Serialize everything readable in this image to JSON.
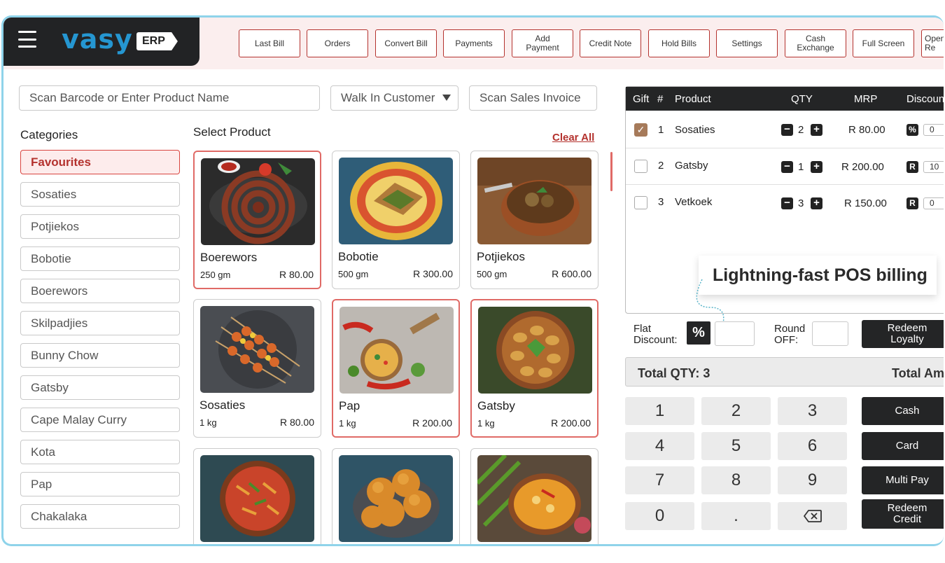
{
  "app": {
    "logo_text": "vasy",
    "logo_badge": "ERP"
  },
  "toolbar": [
    {
      "label": "Last Bill"
    },
    {
      "label": "Orders"
    },
    {
      "label": "Convert Bill"
    },
    {
      "label": "Payments"
    },
    {
      "label": "Add Payment"
    },
    {
      "label": "Credit Note"
    },
    {
      "label": "Hold Bills"
    },
    {
      "label": "Settings"
    },
    {
      "label": "Cash Exchange"
    },
    {
      "label": "Full Screen"
    },
    {
      "label": "Open Re"
    }
  ],
  "search": {
    "product_placeholder": "Scan Barcode or Enter Product Name",
    "customer": "Walk In Customer",
    "invoice_placeholder": "Scan Sales Invoice"
  },
  "categories": {
    "title": "Categories",
    "items": [
      "Favourites",
      "Sosaties",
      "Potjiekos",
      "Bobotie",
      "Boerewors",
      "Skilpadjies",
      "Bunny Chow",
      "Gatsby",
      "Cape Malay Curry",
      "Kota",
      "Pap",
      "Chakalaka"
    ],
    "active": "Favourites"
  },
  "products": {
    "title": "Select Product",
    "clear_all": "Clear All",
    "items": [
      {
        "name": "Boerewors",
        "weight": "250 gm",
        "price": "R 80.00",
        "selected": true
      },
      {
        "name": "Bobotie",
        "weight": "500 gm",
        "price": "R 300.00",
        "selected": false
      },
      {
        "name": "Potjiekos",
        "weight": "500 gm",
        "price": "R 600.00",
        "selected": false
      },
      {
        "name": "Sosaties",
        "weight": "1 kg",
        "price": "R 80.00",
        "selected": false
      },
      {
        "name": "Pap",
        "weight": "1 kg",
        "price": "R 200.00",
        "selected": true
      },
      {
        "name": "Gatsby",
        "weight": "1 kg",
        "price": "R 200.00",
        "selected": true
      },
      {
        "name": "",
        "weight": "",
        "price": "",
        "selected": false
      },
      {
        "name": "",
        "weight": "",
        "price": "",
        "selected": false
      },
      {
        "name": "",
        "weight": "",
        "price": "",
        "selected": false
      }
    ]
  },
  "cart": {
    "headers": {
      "gift": "Gift",
      "num": "#",
      "product": "Product",
      "qty": "QTY",
      "mrp": "MRP",
      "discount": "Discount"
    },
    "rows": [
      {
        "num": "1",
        "product": "Sosaties",
        "qty": "2",
        "mrp": "R 80.00",
        "disc_type": "%",
        "disc": "0",
        "gift": true
      },
      {
        "num": "2",
        "product": "Gatsby",
        "qty": "1",
        "mrp": "R 200.00",
        "disc_type": "R",
        "disc": "10",
        "gift": false
      },
      {
        "num": "3",
        "product": "Vetkoek",
        "qty": "3",
        "mrp": "R 150.00",
        "disc_type": "R",
        "disc": "0",
        "gift": false
      }
    ]
  },
  "callout": "Lightning-fast POS billing",
  "discounts": {
    "flat_label": "Flat Discount:",
    "pct_symbol": "%",
    "round_label": "Round OFF:",
    "redeem_loyalty": "Redeem Loyalty"
  },
  "totals": {
    "qty_label": "Total QTY: 3",
    "amount_label": "Total Amo"
  },
  "keypad": [
    "1",
    "2",
    "3",
    "4",
    "5",
    "6",
    "7",
    "8",
    "9",
    "0",
    "."
  ],
  "payments": [
    "Cash",
    "Card",
    "Multi Pay",
    "Redeem Credit"
  ],
  "colors": {
    "accent": "#b4322e",
    "dark": "#242526",
    "logo_blue": "#2596d1",
    "frame": "#8fd3ea"
  }
}
